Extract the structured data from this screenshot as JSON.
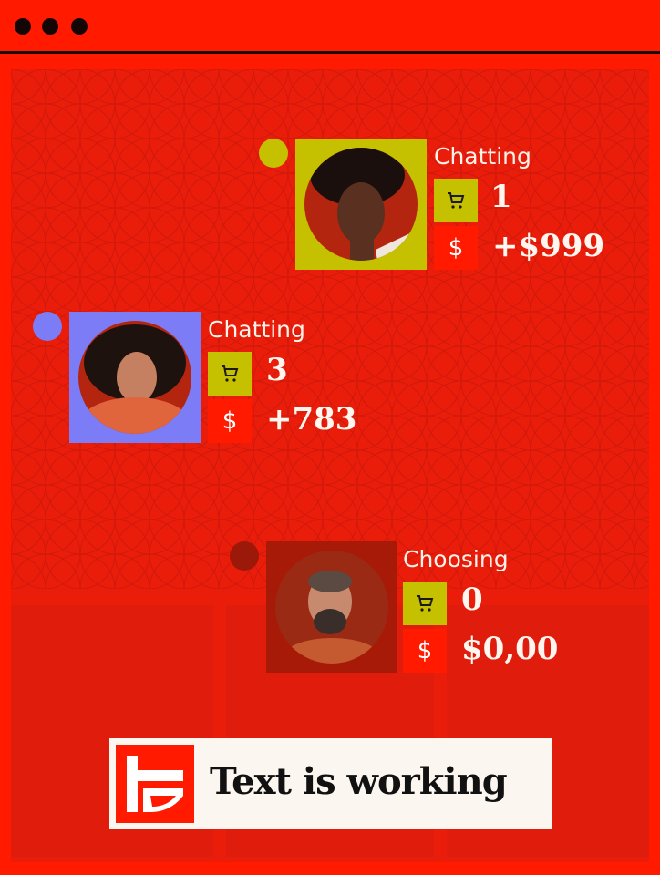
{
  "window": {
    "controls": [
      "dot",
      "dot",
      "dot"
    ]
  },
  "colors": {
    "background": "#ff1a00",
    "cart_square": "#c5c000",
    "card1_frame": "#c5c000",
    "card2_frame": "#7b7cf6",
    "card3_frame": "#a81a08",
    "card1_status_dot": "#c5c000",
    "card2_status_dot": "#7b7cf6",
    "card3_status_dot": "#9c1808"
  },
  "cards": [
    {
      "status": "Chatting",
      "cart_count": "1",
      "amount": "+$999",
      "cart_icon": "cart-icon",
      "currency_icon": "dollar-icon",
      "currency_symbol": "$"
    },
    {
      "status": "Chatting",
      "cart_count": "3",
      "amount": "+783",
      "cart_icon": "cart-icon",
      "currency_icon": "dollar-icon",
      "currency_symbol": "$"
    },
    {
      "status": "Choosing",
      "cart_count": "0",
      "amount": "$0,00",
      "cart_icon": "cart-icon",
      "currency_icon": "dollar-icon",
      "currency_symbol": "$"
    }
  ],
  "banner": {
    "text": "Text is working",
    "logo_icon": "brand-logo-icon"
  }
}
